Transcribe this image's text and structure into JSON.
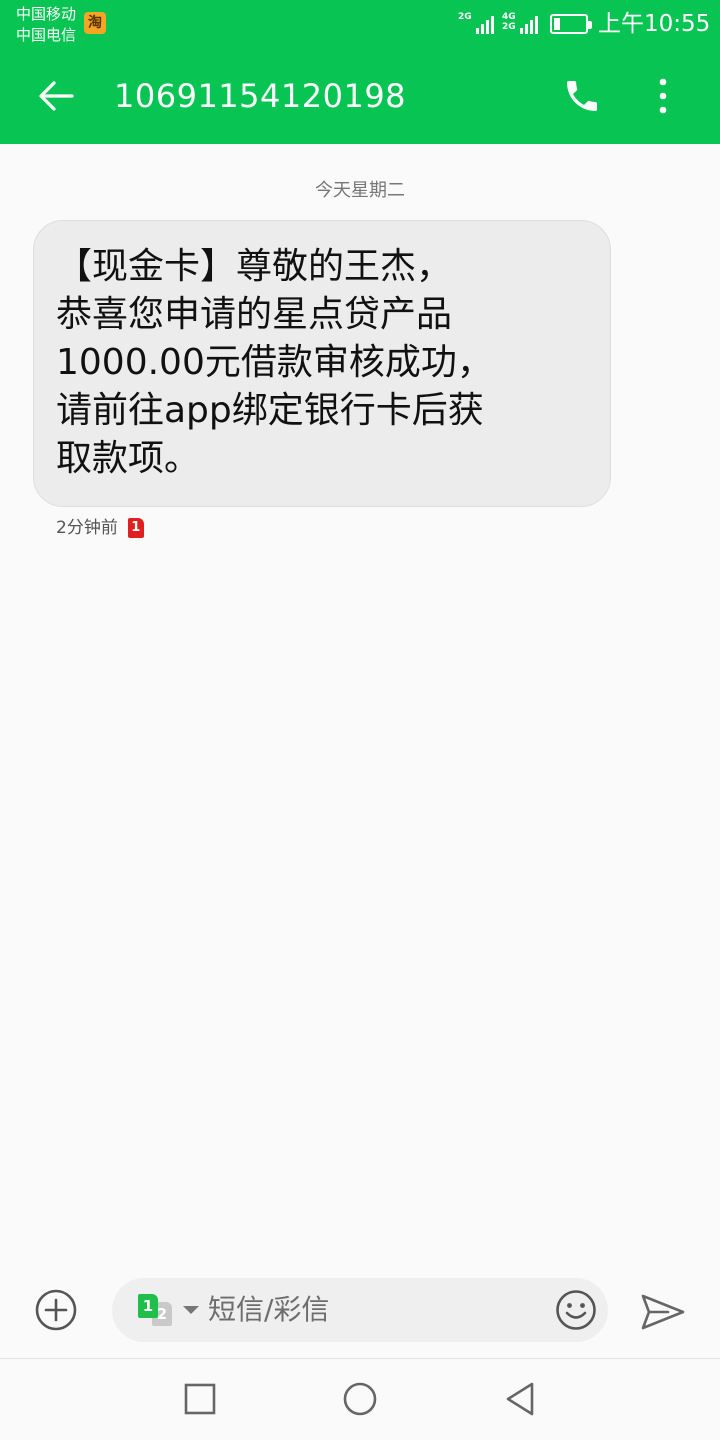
{
  "status_bar": {
    "carrier_1": "中国移动",
    "carrier_2": "中国电信",
    "app_badge": "淘",
    "network_1": "2G",
    "network_2_top": "4G",
    "network_2_bottom": "2G",
    "battery_level": 0.2,
    "time": "上午10:55"
  },
  "header": {
    "title": "10691154120198",
    "back_icon": "arrow-left-icon",
    "call_icon": "phone-icon",
    "more_icon": "more-vertical-icon"
  },
  "conversation": {
    "date_separator": "今天星期二",
    "messages": [
      {
        "text": "【现金卡】尊敬的王杰，\n恭喜您申请的星点贷产品\n1000.00元借款审核成功，\n请前往app绑定银行卡后获\n取款项。",
        "time": "2分钟前",
        "sim": "1"
      }
    ]
  },
  "composer": {
    "add_icon": "plus-circle-icon",
    "sim_primary": "1",
    "sim_secondary": "2",
    "placeholder": "短信/彩信",
    "emoji_icon": "smiley-icon",
    "send_icon": "send-icon"
  },
  "nav": {
    "recents_icon": "square-icon",
    "home_icon": "circle-icon",
    "back_icon": "triangle-back-icon"
  },
  "colors": {
    "header_green": "#08c553",
    "bubble_bg": "#ececec",
    "sim1_badge": "#e02020"
  }
}
